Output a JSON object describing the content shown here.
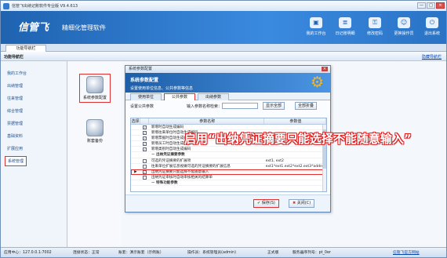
{
  "window": {
    "title": "信管飞出纳记账软件专业版 V9.4.613",
    "controls": [
      "—",
      "□",
      "✕"
    ]
  },
  "banner": {
    "logo": "信管飞",
    "slogan": "精细化管理软件",
    "tools": [
      {
        "label": "我的工作台",
        "icon": "desk-icon"
      },
      {
        "label": "日记账明细",
        "icon": "journal-icon"
      },
      {
        "label": "修改密码",
        "icon": "key-icon"
      },
      {
        "label": "更换操作员",
        "icon": "user-icon"
      },
      {
        "label": "退出系统",
        "icon": "power-icon"
      }
    ]
  },
  "tabstrip": {
    "active_tab": "功能导航栏"
  },
  "nav_header": {
    "title": "功能导航栏",
    "right_link": "隐藏导航栏"
  },
  "sidebar": {
    "items": [
      "我的工作台",
      "出纳管理",
      "往来管理",
      "综合管理",
      "票据管理",
      "基础资料",
      "扩展应用",
      "系统管理"
    ],
    "active": "系统管理"
  },
  "modules": [
    {
      "label": "系统参数配置",
      "active": true
    },
    {
      "label": "账套备份",
      "active": false
    }
  ],
  "dialog": {
    "title": "系统参数配置",
    "close_label": "×",
    "header_title": "系统参数配置",
    "header_sub": "设置使用单位信息、公共参数等信息",
    "tabs": [
      "使用单位",
      "公共参数",
      "出纳参数"
    ],
    "active_tab": "公共参数",
    "search": {
      "label1": "设置公共参数",
      "label2": "输入参数名称检索：",
      "value": "",
      "show_all": "显示全部",
      "select_all": "全部折叠"
    },
    "grid": {
      "columns": [
        "选择",
        "",
        "参数名称",
        "参数值"
      ],
      "rows": [
        {
          "group": false,
          "checked": true,
          "name": "新增时自动生成编码",
          "value": ""
        },
        {
          "group": false,
          "checked": true,
          "name": "新增往来单位时自动生成编码",
          "value": ""
        },
        {
          "group": false,
          "checked": true,
          "name": "新增票据时自动生成编码",
          "value": ""
        },
        {
          "group": false,
          "checked": true,
          "name": "新增员工时自动生成编码",
          "value": ""
        },
        {
          "group": false,
          "checked": true,
          "name": "新增类别时自动生成编码",
          "value": ""
        },
        {
          "group": true,
          "checked": false,
          "name": "出纳凭证摘要参数",
          "value": ""
        },
        {
          "group": false,
          "checked": false,
          "name": "可选的凭证摘要的扩展项",
          "value": "ext1, ext2"
        },
        {
          "group": false,
          "checked": false,
          "name": "往来单位扩展信息视做可选的凭证摘要的扩展信息",
          "value": "ext1*ext1.ext2*ext2.ext3*address"
        },
        {
          "group": false,
          "checked": true,
          "name": "出纳凭证摘要只能选择不能随意输入",
          "value": "",
          "selected": true
        },
        {
          "group": false,
          "checked": false,
          "name": "出纳凭证审核时自动审核相关的结算单",
          "value": ""
        },
        {
          "group": true,
          "checked": false,
          "name": "特殊功能参数",
          "value": ""
        }
      ]
    },
    "buttons": {
      "save": "保存(S)",
      "close": "关闭(C)"
    }
  },
  "callout": "启用“出纳凭证摘要只能选择不能随意输入”",
  "statusbar": {
    "server": "应用中心：127.0.0.1:7002",
    "conn": "连接状态：正常",
    "ledger": "账套：演示账套（示例账）",
    "operator": "操作员：系统管理员(admin)",
    "version": "正式版",
    "machine": "服务器序列号：pt_0er",
    "link": "信管飞官方网站"
  },
  "colors": {
    "accent": "#1f63b0",
    "highlight": "#e03030"
  }
}
